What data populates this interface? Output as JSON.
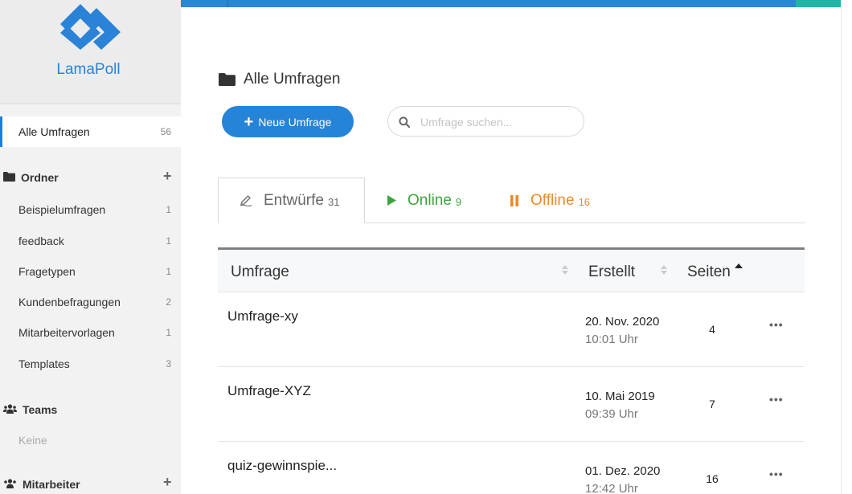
{
  "brand": {
    "name": "LamaPoll",
    "color": "#2a83d6"
  },
  "sidebar": {
    "all_surveys": {
      "label": "Alle Umfragen",
      "count": "56"
    },
    "folders": {
      "title": "Ordner",
      "items": [
        {
          "label": "Beispielumfragen",
          "count": "1"
        },
        {
          "label": "feedback",
          "count": "1"
        },
        {
          "label": "Fragetypen",
          "count": "1"
        },
        {
          "label": "Kundenbefragungen",
          "count": "2"
        },
        {
          "label": "Mitarbeitervorlagen",
          "count": "1"
        },
        {
          "label": "Templates",
          "count": "3"
        }
      ]
    },
    "teams": {
      "title": "Teams",
      "empty": "Keine"
    },
    "staff": {
      "title": "Mitarbeiter"
    }
  },
  "main": {
    "title": "Alle Umfragen",
    "new_survey_label": "Neue Umfrage",
    "search_placeholder": "Umfrage suchen...",
    "tabs": [
      {
        "label": "Entwürfe",
        "count": "31",
        "color": "#666666"
      },
      {
        "label": "Online",
        "count": "9",
        "color": "#3ea33e"
      },
      {
        "label": "Offline",
        "count": "16",
        "color": "#ea8a2a"
      }
    ]
  },
  "table": {
    "headers": {
      "survey": "Umfrage",
      "created": "Erstellt",
      "pages": "Seiten"
    },
    "rows": [
      {
        "name": "Umfrage-xy",
        "date": "20. Nov. 2020",
        "time": "10:01 Uhr",
        "pages": "4"
      },
      {
        "name": "Umfrage-XYZ",
        "date": "10. Mai 2019",
        "time": "09:39 Uhr",
        "pages": "7"
      },
      {
        "name": "quiz-gewinnspie...",
        "date": "01. Dez. 2020",
        "time": "12:42 Uhr",
        "pages": "16"
      }
    ]
  },
  "colors": {
    "accent": "#2584d8",
    "topbar": "#2a86d8",
    "teal": "#1fb6a5"
  }
}
